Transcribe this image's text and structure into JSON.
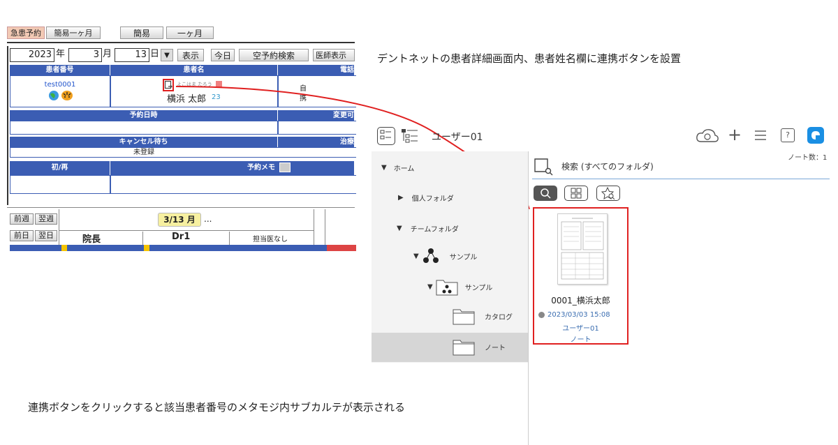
{
  "annotations": {
    "top": "デントネットの患者詳細画面内、患者姓名欄に連携ボタンを設置",
    "bottom": "連携ボタンをクリックすると該当患者番号のメタモジ内サブカルテが表示される"
  },
  "reservation": {
    "tabs": [
      "急患予約",
      "簡易一ヶ月",
      "簡易",
      "一ヶ月"
    ],
    "date": {
      "year": "2023",
      "year_unit": "年",
      "month": "3",
      "month_unit": "月",
      "day": "13",
      "day_unit": "日"
    },
    "dropdown_arrow": "▼",
    "buttons": [
      "表示",
      "今日",
      "空予約検索",
      "医師表示"
    ],
    "headers": {
      "patient_no": "患者番号",
      "patient_name": "患者名",
      "phone": "電話",
      "appt_datetime": "予約日時",
      "changeable": "変更可",
      "cancel_wait": "キャンセル待ち",
      "treatment": "治療",
      "first_return": "初/再",
      "memo": "予約メモ"
    },
    "patient": {
      "id": "test0001",
      "furigana": "よこはま たろう",
      "name": "横浜 太郎",
      "age": "23",
      "phone_c1": "自",
      "phone_c2": "携"
    },
    "cancel_status": "未登録",
    "nav": {
      "prev_week": "前週",
      "next_week": "翌週",
      "prev_day": "前日",
      "next_day": "翌日"
    },
    "schedule": {
      "date_label": "3/13 月",
      "ellipsis": "...",
      "columns": [
        "院長",
        "Dr1",
        "担当医なし"
      ]
    },
    "accent_blue": "#3b5db3",
    "accent_red": "#e02020"
  },
  "metamoji": {
    "user": "ユーザー01",
    "note_count": "ノート数：1",
    "search_title": "検索 (すべてのフォルダ)",
    "tree": {
      "home": "ホーム",
      "personal": "個人フォルダ",
      "team": "チームフォルダ",
      "sample1": "サンプル",
      "sample2": "サンプル",
      "catalog": "カタログ",
      "note": "ノート"
    },
    "doc": {
      "title": "0001_横浜太郎",
      "date": "2023/03/03 15:08",
      "user": "ユーザー01",
      "type": "ノート"
    },
    "icons": [
      "list-view-icon",
      "tree-view-icon",
      "cloud-sync-icon",
      "add-icon",
      "menu-icon",
      "help-icon",
      "app-icon",
      "search-icon",
      "grid-icon",
      "favorite-icon"
    ]
  }
}
